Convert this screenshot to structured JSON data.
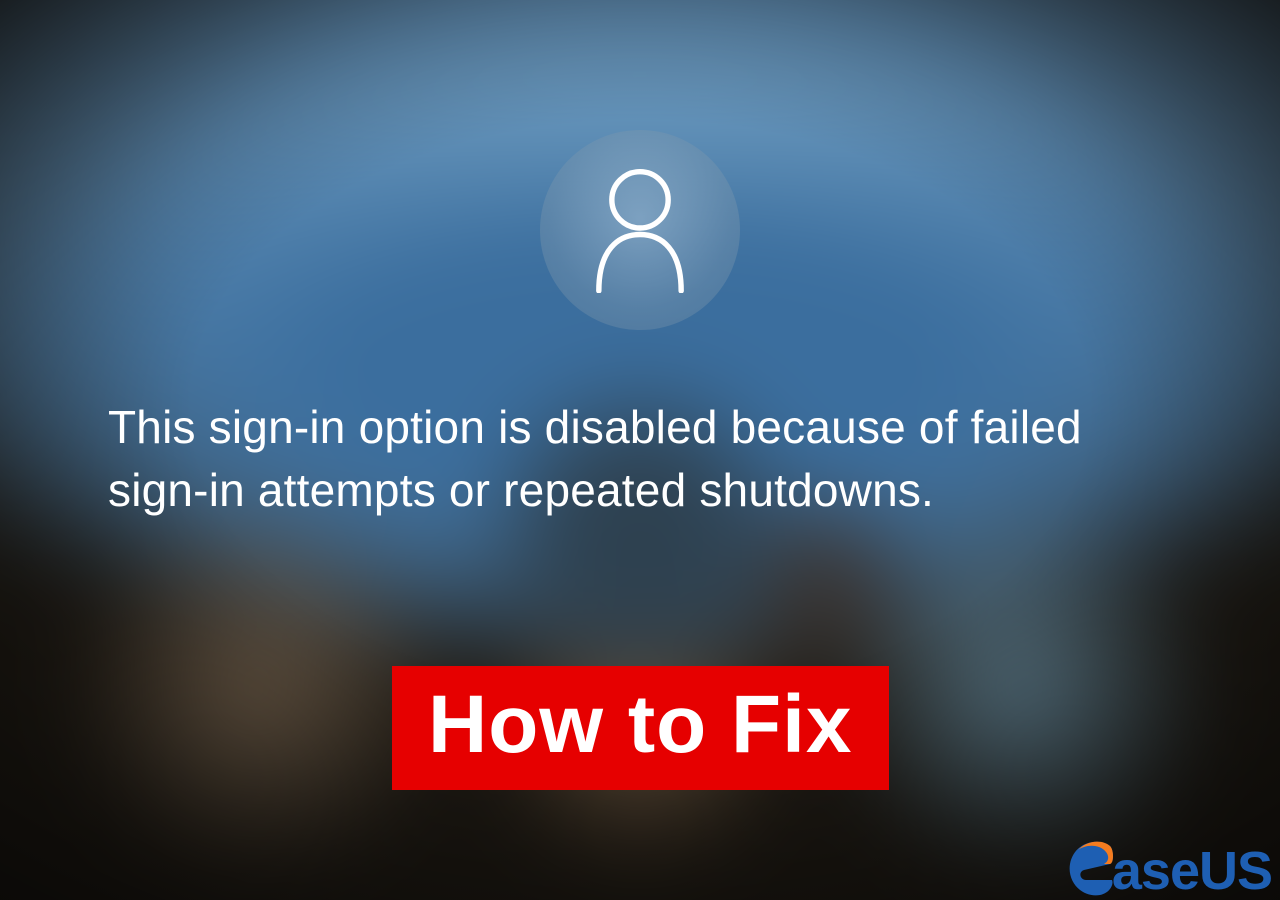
{
  "lockscreen": {
    "error_message": "This sign-in option is disabled because of failed sign-in attempts or repeated shutdowns."
  },
  "overlay": {
    "how_to_fix_label": "How to Fix"
  },
  "brand": {
    "name": "aseUS",
    "full_name": "EaseUS"
  }
}
